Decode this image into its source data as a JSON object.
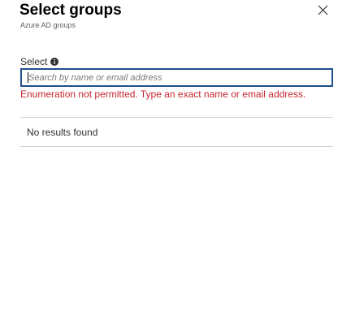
{
  "header": {
    "title": "Select groups",
    "subtitle": "Azure AD groups",
    "close_icon": "close-icon"
  },
  "select_field": {
    "label": "Select",
    "info_icon": "info-icon",
    "placeholder": "Search by name or email address",
    "value": "",
    "error": "Enumeration not permitted. Type an exact name or email address."
  },
  "results": {
    "empty_message": "No results found"
  },
  "colors": {
    "input_border": "#1f4e8c",
    "error_text": "#c4262e",
    "divider": "#d2d0ce"
  }
}
